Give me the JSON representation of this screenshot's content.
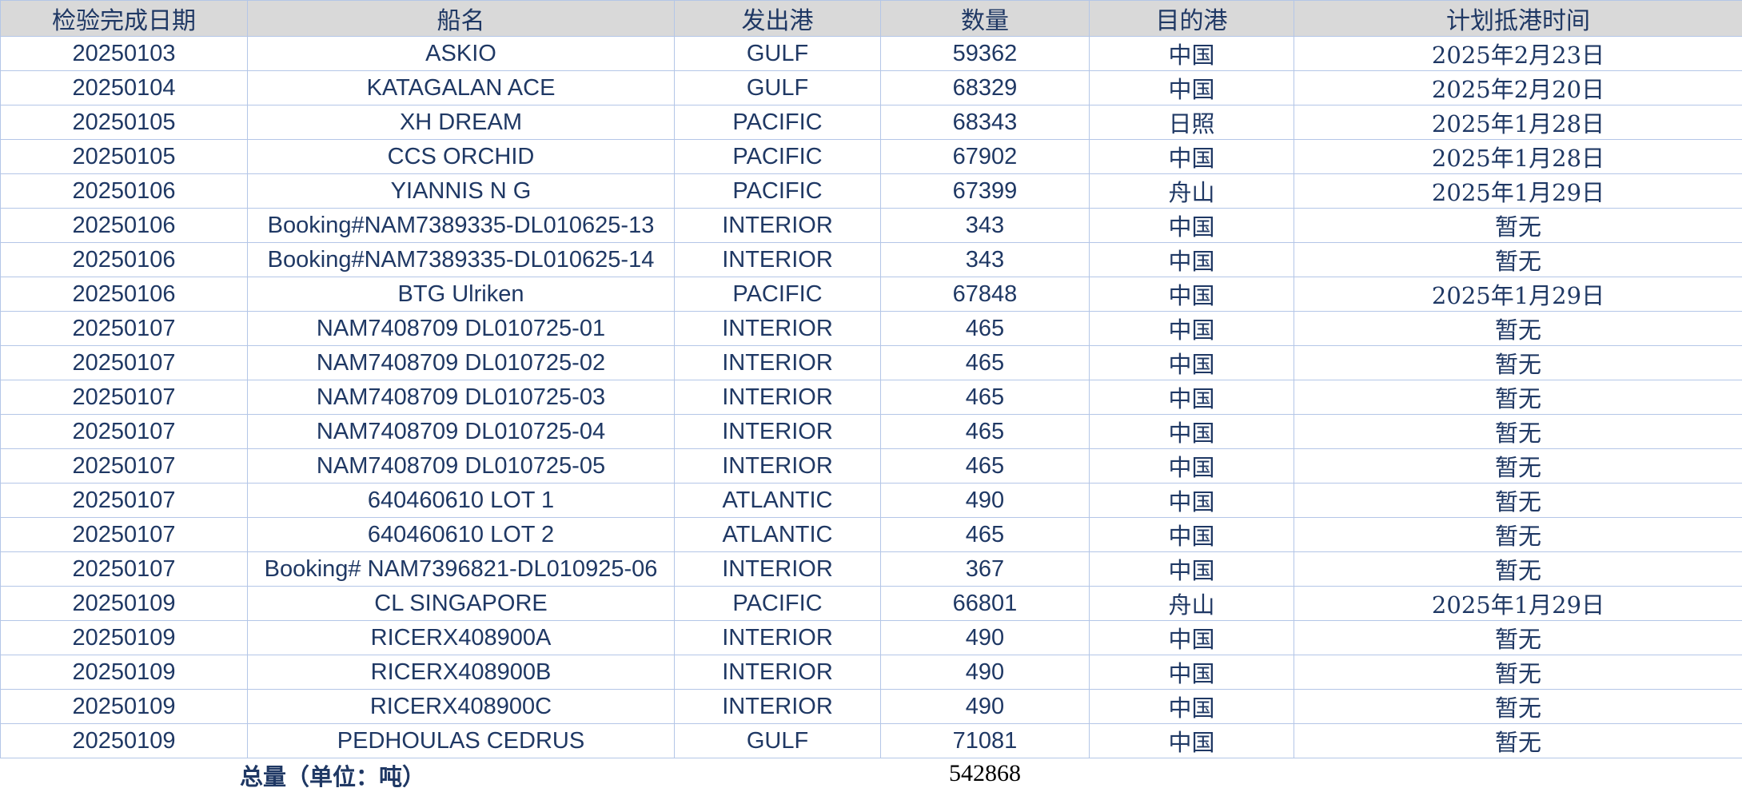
{
  "headers": [
    "检验完成日期",
    "船名",
    "发出港",
    "数量",
    "目的港",
    "计划抵港时间"
  ],
  "rows": [
    [
      "20250103",
      "ASKIO",
      "GULF",
      "59362",
      "中国",
      "2025年2月23日"
    ],
    [
      "20250104",
      "KATAGALAN ACE",
      "GULF",
      "68329",
      "中国",
      "2025年2月20日"
    ],
    [
      "20250105",
      "XH DREAM",
      "PACIFIC",
      "68343",
      "日照",
      "2025年1月28日"
    ],
    [
      "20250105",
      "CCS ORCHID",
      "PACIFIC",
      "67902",
      "中国",
      "2025年1月28日"
    ],
    [
      "20250106",
      "YIANNIS N G",
      "PACIFIC",
      "67399",
      "舟山",
      "2025年1月29日"
    ],
    [
      "20250106",
      "Booking#NAM7389335-DL010625-13",
      "INTERIOR",
      "343",
      "中国",
      "暂无"
    ],
    [
      "20250106",
      "Booking#NAM7389335-DL010625-14",
      "INTERIOR",
      "343",
      "中国",
      "暂无"
    ],
    [
      "20250106",
      "BTG Ulriken",
      "PACIFIC",
      "67848",
      "中国",
      "2025年1月29日"
    ],
    [
      "20250107",
      "NAM7408709 DL010725-01",
      "INTERIOR",
      "465",
      "中国",
      "暂无"
    ],
    [
      "20250107",
      "NAM7408709 DL010725-02",
      "INTERIOR",
      "465",
      "中国",
      "暂无"
    ],
    [
      "20250107",
      "NAM7408709 DL010725-03",
      "INTERIOR",
      "465",
      "中国",
      "暂无"
    ],
    [
      "20250107",
      "NAM7408709 DL010725-04",
      "INTERIOR",
      "465",
      "中国",
      "暂无"
    ],
    [
      "20250107",
      "NAM7408709 DL010725-05",
      "INTERIOR",
      "465",
      "中国",
      "暂无"
    ],
    [
      "20250107",
      "640460610 LOT 1",
      "ATLANTIC",
      "490",
      "中国",
      "暂无"
    ],
    [
      "20250107",
      "640460610 LOT 2",
      "ATLANTIC",
      "465",
      "中国",
      "暂无"
    ],
    [
      "20250107",
      "Booking# NAM7396821-DL010925-06",
      "INTERIOR",
      "367",
      "中国",
      "暂无"
    ],
    [
      "20250109",
      "CL SINGAPORE",
      "PACIFIC",
      "66801",
      "舟山",
      "2025年1月29日"
    ],
    [
      "20250109",
      "RICERX408900A",
      "INTERIOR",
      "490",
      "中国",
      "暂无"
    ],
    [
      "20250109",
      "RICERX408900B",
      "INTERIOR",
      "490",
      "中国",
      "暂无"
    ],
    [
      "20250109",
      "RICERX408900C",
      "INTERIOR",
      "490",
      "中国",
      "暂无"
    ],
    [
      "20250109",
      "PEDHOULAS CEDRUS",
      "GULF",
      "71081",
      "中国",
      "暂无"
    ]
  ],
  "total": {
    "label": "总量（单位：吨）",
    "value": "542868"
  },
  "colors": {
    "header_bg": "#d9d9d9",
    "grid": "#b4c6e7",
    "text": "#1f3864"
  }
}
